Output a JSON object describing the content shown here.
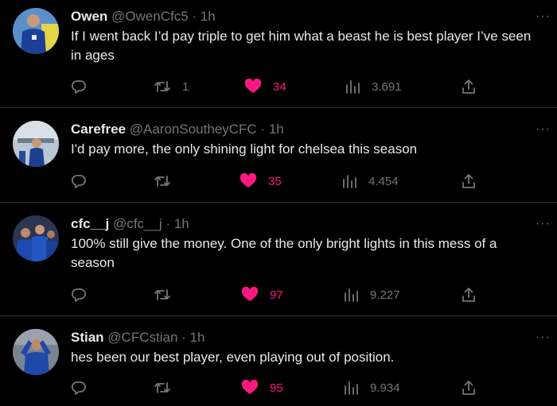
{
  "tweets": [
    {
      "name": "Owen",
      "handle": "@OwenCfc5",
      "time": "1h",
      "text": "If I went back I’d pay triple to get him what a beast he is best player I’ve seen in ages",
      "replies": "",
      "retweets": "1",
      "likes": "34",
      "views": "3.691",
      "liked": true
    },
    {
      "name": "Carefree",
      "handle": "@AaronSoutheyCFC",
      "time": "1h",
      "text": "I'd pay more, the only shining light for chelsea this season",
      "replies": "",
      "retweets": "",
      "likes": "35",
      "views": "4.454",
      "liked": true
    },
    {
      "name": "cfc__j",
      "handle": "@cfc__j",
      "time": "1h",
      "text": "100% still give the money. One of the only bright lights in this mess of a season",
      "replies": "",
      "retweets": "",
      "likes": "97",
      "views": "9.227",
      "liked": true
    },
    {
      "name": "Stian",
      "handle": "@CFCstian",
      "time": "1h",
      "text": "hes been our best player, even playing out of position.",
      "replies": "",
      "retweets": "",
      "likes": "95",
      "views": "9.934",
      "liked": true
    }
  ],
  "separator": "·",
  "more_glyph": "···",
  "icons": {
    "reply": "reply-icon",
    "retweet": "retweet-icon",
    "like": "heart-icon",
    "views": "views-icon",
    "share": "share-icon"
  },
  "colors": {
    "background": "#000000",
    "text": "#e7e9ea",
    "muted": "#71767b",
    "like": "#f91880",
    "border": "#2f3336"
  }
}
